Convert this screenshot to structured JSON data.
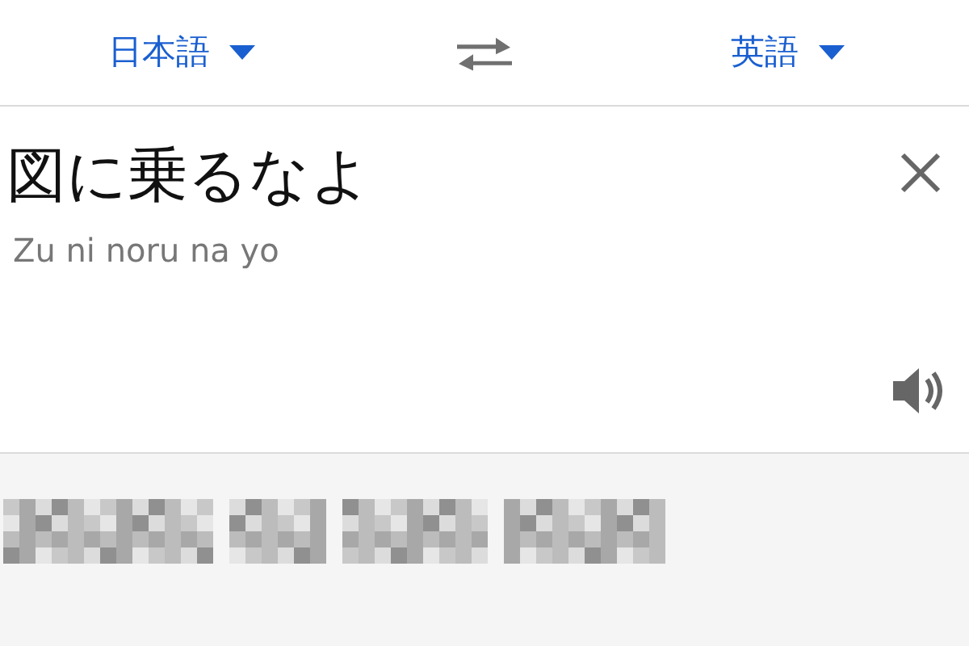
{
  "language_bar": {
    "source_language": "日本語",
    "target_language": "英語"
  },
  "input": {
    "text": "図に乗るなよ",
    "romanization": "Zu ni noru na yo"
  }
}
